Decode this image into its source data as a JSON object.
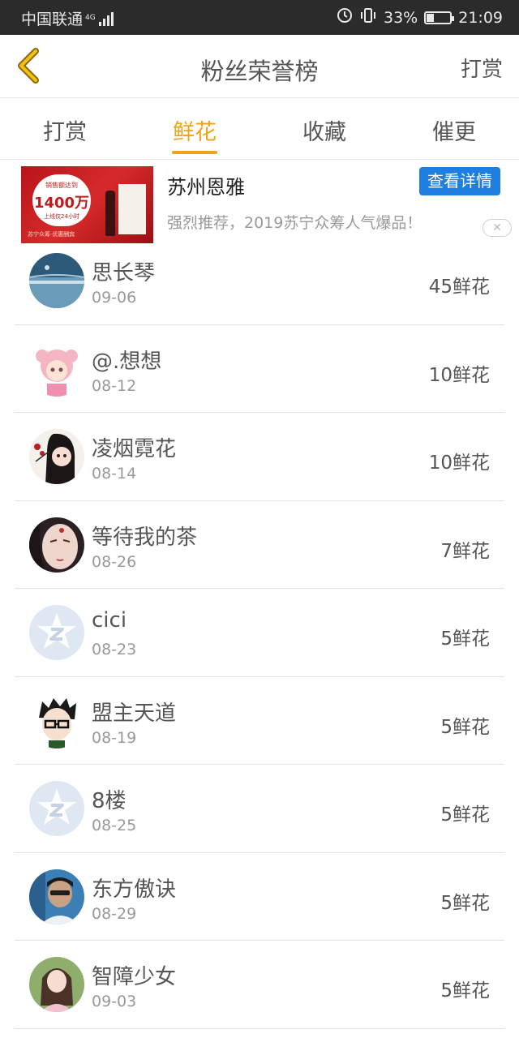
{
  "status_bar": {
    "carrier": "中国联通",
    "network": "4G",
    "battery": "33%",
    "battery_level": 0.33,
    "time": "21:09"
  },
  "header": {
    "title": "粉丝荣誉榜",
    "right_action": "打赏",
    "back_icon": "chevron-left-icon",
    "accent_color": "#f0a218"
  },
  "tabs": [
    {
      "label": "打赏",
      "active": false
    },
    {
      "label": "鲜花",
      "active": true
    },
    {
      "label": "收藏",
      "active": false
    },
    {
      "label": "催更",
      "active": false
    }
  ],
  "ad": {
    "title": "苏州恩雅",
    "cta": "查看详情",
    "description": "强烈推荐，2019苏宁众筹人气爆品！",
    "image_text_1": "销售额达到",
    "image_text_2": "1400万",
    "image_text_3": "上线仅24小时",
    "image_text_4": "苏宁众筹·优惠酬宾",
    "close_icon": "close-icon",
    "cta_color": "#1e7fe0"
  },
  "fans": [
    {
      "name": "思长琴",
      "date": "09-06",
      "flowers": "45鲜花",
      "avatar": "landscape"
    },
    {
      "name": "@.想想",
      "date": "08-12",
      "flowers": "10鲜花",
      "avatar": "anime-girl-pink"
    },
    {
      "name": "凌烟霓花",
      "date": "08-14",
      "flowers": "10鲜花",
      "avatar": "anime-girl-dark"
    },
    {
      "name": "等待我的茶",
      "date": "08-26",
      "flowers": "7鲜花",
      "avatar": "painted-face"
    },
    {
      "name": "cici",
      "date": "08-23",
      "flowers": "5鲜花",
      "avatar": "default-z"
    },
    {
      "name": "盟主天道",
      "date": "08-19",
      "flowers": "5鲜花",
      "avatar": "cartoon-boy"
    },
    {
      "name": "8楼",
      "date": "08-25",
      "flowers": "5鲜花",
      "avatar": "default-z"
    },
    {
      "name": "东方傲诀",
      "date": "08-29",
      "flowers": "5鲜花",
      "avatar": "photo-man"
    },
    {
      "name": "智障少女",
      "date": "09-03",
      "flowers": "5鲜花",
      "avatar": "photo-girl"
    }
  ]
}
